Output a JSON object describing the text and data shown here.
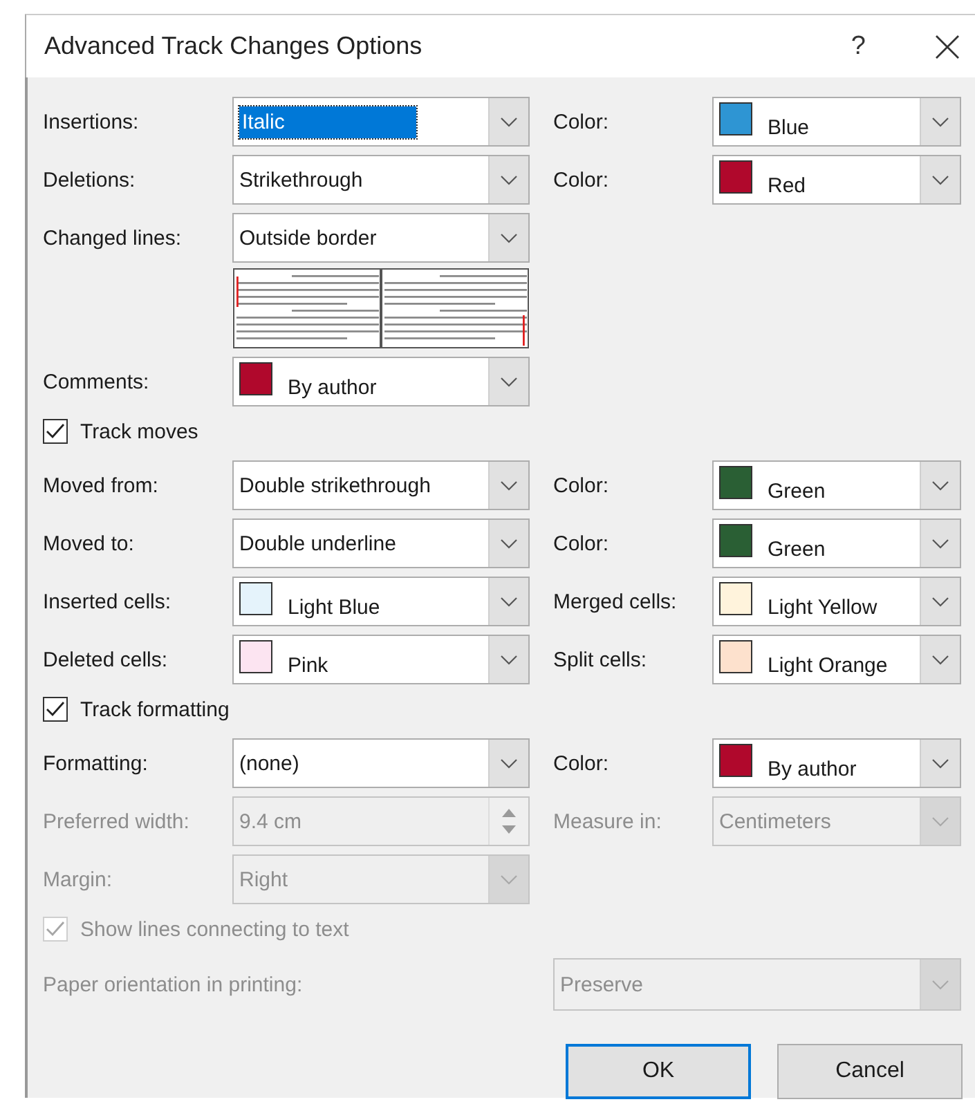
{
  "window": {
    "title": "Advanced Track Changes Options",
    "help": "?"
  },
  "rows": [
    {
      "kind": "fields",
      "fields": [
        {
          "label": "Insertions:",
          "kind": "combo",
          "value": "Italic",
          "focused": true,
          "disabled": false
        },
        {
          "label": "Color:",
          "kind": "color_combo",
          "value": "Blue",
          "color": "#2e95d3",
          "focused": false,
          "disabled": false
        }
      ]
    },
    {
      "kind": "fields",
      "fields": [
        {
          "label": "Deletions:",
          "kind": "combo",
          "value": "Strikethrough",
          "focused": false,
          "disabled": false
        },
        {
          "label": "Color:",
          "kind": "color_combo",
          "value": "Red",
          "color": "#b0082c",
          "focused": false,
          "disabled": false
        }
      ]
    },
    {
      "kind": "fields",
      "fields": [
        {
          "label": "Changed lines:",
          "kind": "combo",
          "value": "Outside border",
          "focused": false,
          "disabled": false
        }
      ]
    },
    {
      "kind": "preview"
    },
    {
      "kind": "fields",
      "fields": [
        {
          "label": "Comments:",
          "kind": "color_combo",
          "value": "By author",
          "color": "#b0082c",
          "focused": false,
          "disabled": false
        }
      ]
    },
    {
      "kind": "checkbox",
      "label": "Track moves",
      "checked": true,
      "disabled": false
    },
    {
      "kind": "fields",
      "fields": [
        {
          "label": "Moved from:",
          "kind": "combo",
          "value": "Double strikethrough",
          "focused": false,
          "disabled": false
        },
        {
          "label": "Color:",
          "kind": "color_combo",
          "value": "Green",
          "color": "#2a5f34",
          "focused": false,
          "disabled": false
        }
      ]
    },
    {
      "kind": "fields",
      "fields": [
        {
          "label": "Moved to:",
          "kind": "combo",
          "value": "Double underline",
          "focused": false,
          "disabled": false
        },
        {
          "label": "Color:",
          "kind": "color_combo",
          "value": "Green",
          "color": "#2a5f34",
          "focused": false,
          "disabled": false
        }
      ]
    },
    {
      "kind": "fields",
      "fields": [
        {
          "label": "Inserted cells:",
          "kind": "color_combo",
          "value": "Light Blue",
          "color": "#e5f3fb",
          "focused": false,
          "disabled": false
        },
        {
          "label": "Merged cells:",
          "kind": "color_combo",
          "value": "Light Yellow",
          "color": "#fff3dc",
          "focused": false,
          "disabled": false
        }
      ]
    },
    {
      "kind": "fields",
      "fields": [
        {
          "label": "Deleted cells:",
          "kind": "color_combo",
          "value": "Pink",
          "color": "#fce4f1",
          "focused": false,
          "disabled": false
        },
        {
          "label": "Split cells:",
          "kind": "color_combo",
          "value": "Light Orange",
          "color": "#fde1cd",
          "focused": false,
          "disabled": false
        }
      ]
    },
    {
      "kind": "checkbox",
      "label": "Track formatting",
      "checked": true,
      "disabled": false
    },
    {
      "kind": "fields",
      "fields": [
        {
          "label": "Formatting:",
          "kind": "combo",
          "value": "(none)",
          "focused": false,
          "disabled": false
        },
        {
          "label": "Color:",
          "kind": "color_combo",
          "value": "By author",
          "color": "#b0082c",
          "focused": false,
          "disabled": false
        }
      ]
    },
    {
      "kind": "fields",
      "fields": [
        {
          "label": "Preferred width:",
          "kind": "spin",
          "value": "9.4 cm",
          "focused": false,
          "disabled": true
        },
        {
          "label": "Measure in:",
          "kind": "combo",
          "value": "Centimeters",
          "focused": false,
          "disabled": true
        }
      ]
    },
    {
      "kind": "fields",
      "fields": [
        {
          "label": "Margin:",
          "kind": "combo",
          "value": "Right",
          "focused": false,
          "disabled": true
        }
      ]
    },
    {
      "kind": "checkbox",
      "label": "Show lines connecting to text",
      "checked": true,
      "disabled": true
    },
    {
      "kind": "wide",
      "label": "Paper orientation in printing:",
      "value": "Preserve",
      "focused": false,
      "disabled": true
    }
  ],
  "buttons": [
    {
      "label": "OK",
      "default": true
    },
    {
      "label": "Cancel",
      "default": false
    }
  ]
}
